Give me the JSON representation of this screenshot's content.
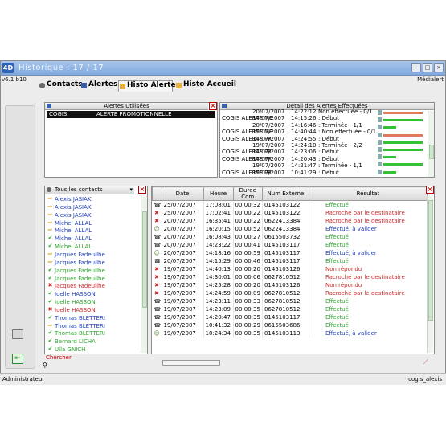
{
  "window": {
    "title": "Historique : 17 / 17",
    "version": "v6.1 b10",
    "org": "Médialert"
  },
  "tabs": [
    {
      "label": "Contacts",
      "icon": "person-icon"
    },
    {
      "label": "Alertes",
      "icon": "speaker-icon"
    },
    {
      "label": "Histo Alertes",
      "icon": "arrow-icon",
      "active": true
    },
    {
      "label": "Histo Accueil",
      "icon": "arrow-icon"
    }
  ],
  "alerts_used": {
    "title": "Alertes Utilisées",
    "rows": [
      {
        "name": "COGIS",
        "type": "ALERTE PROMOTIONNELLE"
      }
    ]
  },
  "alert_details": {
    "title": "Détail des Alertes Effectuées",
    "lines": [
      {
        "left": "",
        "date": "20/07/2007",
        "time": "14:22:12",
        "status": "Non effectuée - 0/1"
      },
      {
        "left": "COGIS ALERTE ME",
        "date": "14/07/2007",
        "time": "14:15:26",
        "status": ": Début"
      },
      {
        "left": "",
        "date": "20/07/2007",
        "time": "14:16:46",
        "status": ": Terminée - 1/1"
      },
      {
        "left": "COGIS ALERTE ME",
        "date": "19/07/2007",
        "time": "14:40:44",
        "status": ": Non effectuée - 0/1"
      },
      {
        "left": "COGIS ALERTE PR",
        "date": "14/07/2007",
        "time": "14:24:55",
        "status": ": Début"
      },
      {
        "left": "",
        "date": "19/07/2007",
        "time": "14:24:10",
        "status": ": Terminée - 2/2"
      },
      {
        "left": "COGIS ALERTE PR",
        "date": "14/07/2007",
        "time": "14:23:06",
        "status": ": Début"
      },
      {
        "left": "COGIS ALERTE PR",
        "date": "14/07/2007",
        "time": "14:20:43",
        "status": ": Début"
      },
      {
        "left": "",
        "date": "19/07/2007",
        "time": "14:21:47",
        "status": ": Terminée - 1/1"
      },
      {
        "left": "COGIS ALERTE PR",
        "date": "19/07/2007",
        "time": "10:41:29",
        "status": ": Début"
      }
    ],
    "bars": [
      {
        "color": "#e07a5a",
        "fill": 0.95
      },
      {
        "color": "#33c233",
        "fill": 0.95
      },
      {
        "color": "#33c233",
        "fill": 0.3
      },
      {
        "color": "#e07a5a",
        "fill": 0.95
      },
      {
        "color": "#33c233",
        "fill": 0.95
      },
      {
        "color": "#33c233",
        "fill": 0.95
      },
      {
        "color": "#33c233",
        "fill": 0.3
      },
      {
        "color": "#33c233",
        "fill": 0.95
      },
      {
        "color": "#33c233",
        "fill": 0.3
      }
    ]
  },
  "contacts": {
    "filter": "Tous les contacts",
    "search_label": "Chercher",
    "items": [
      {
        "name": "Alexis JASIAK",
        "mark": "right",
        "color": "#1f3fb8"
      },
      {
        "name": "Alexis JASIAK",
        "mark": "right",
        "color": "#1f3fb8"
      },
      {
        "name": "Alexis JASIAK",
        "mark": "right",
        "color": "#1f3fb8"
      },
      {
        "name": "Michel ALLAL",
        "mark": "right",
        "color": "#1f3fb8"
      },
      {
        "name": "Michel ALLAL",
        "mark": "right",
        "color": "#1f3fb8"
      },
      {
        "name": "Michel ALLAL",
        "mark": "check",
        "color": "#1f3fb8"
      },
      {
        "name": "Michel ALLAL",
        "mark": "check",
        "color": "#2ea52e"
      },
      {
        "name": "Jacques Fadeuilhe",
        "mark": "right",
        "color": "#1f3fb8"
      },
      {
        "name": "Jacques Fadeuilhe",
        "mark": "right",
        "color": "#1f3fb8"
      },
      {
        "name": "Jacques Fadeuilhe",
        "mark": "check",
        "color": "#2ea52e"
      },
      {
        "name": "Jacques Fadeuilhe",
        "mark": "check",
        "color": "#2ea52e"
      },
      {
        "name": "Jacques Fadeuilhe",
        "mark": "cross",
        "color": "#cc2a2a"
      },
      {
        "name": "Ioelle HASSON",
        "mark": "check",
        "color": "#1f3fb8"
      },
      {
        "name": "Ioelle HASSON",
        "mark": "check",
        "color": "#2ea52e"
      },
      {
        "name": "Ioelle HASSON",
        "mark": "cross",
        "color": "#cc2a2a"
      },
      {
        "name": "Thomas BLETTERI",
        "mark": "check",
        "color": "#1f3fb8"
      },
      {
        "name": "Thomas BLETTERI",
        "mark": "right",
        "color": "#1f3fb8"
      },
      {
        "name": "Thomas BLETTERI",
        "mark": "check",
        "color": "#2ea52e"
      },
      {
        "name": "Bernard LICHA",
        "mark": "check",
        "color": "#2ea52e"
      },
      {
        "name": "Ulla GNICH",
        "mark": "check",
        "color": "#2ea52e"
      }
    ]
  },
  "calls": {
    "headers": [
      "Date",
      "Heure",
      "Duree Com",
      "Num Externe",
      "Résultat"
    ],
    "rows": [
      {
        "icon": "phone",
        "date": "25/07/2007",
        "heure": "17:08:01",
        "duree": "00:00:32",
        "num": "0145103122",
        "resultat": "Effectué",
        "rcolor": "#2ea52e"
      },
      {
        "icon": "cross",
        "date": "25/07/2007",
        "heure": "17:02:41",
        "duree": "00:00:22",
        "num": "0145103122",
        "resultat": "Racroché par le destinataire",
        "rcolor": "#cc2a2a"
      },
      {
        "icon": "cross",
        "date": "20/07/2007",
        "heure": "16:35:41",
        "duree": "00:00:22",
        "num": "0622413384",
        "resultat": "Racroché par le destinataire",
        "rcolor": "#cc2a2a"
      },
      {
        "icon": "person",
        "date": "20/07/2007",
        "heure": "16:20:15",
        "duree": "00:00:52",
        "num": "0622413384",
        "resultat": "Effectué, à valider",
        "rcolor": "#1f3fb8"
      },
      {
        "icon": "phone",
        "date": "20/07/2007",
        "heure": "16:08:43",
        "duree": "00:00:27",
        "num": "0615503732",
        "resultat": "Effectué",
        "rcolor": "#2ea52e"
      },
      {
        "icon": "phone",
        "date": "20/07/2007",
        "heure": "14:23:22",
        "duree": "00:00:41",
        "num": "0145103117",
        "resultat": "Effectué",
        "rcolor": "#2ea52e"
      },
      {
        "icon": "person",
        "date": "20/07/2007",
        "heure": "14:18:16",
        "duree": "00:00:59",
        "num": "0145103117",
        "resultat": "Effectué, à valider",
        "rcolor": "#1f3fb8"
      },
      {
        "icon": "phone",
        "date": "20/07/2007",
        "heure": "14:15:29",
        "duree": "00:00:46",
        "num": "0145103117",
        "resultat": "Effectué",
        "rcolor": "#2ea52e"
      },
      {
        "icon": "cross",
        "date": "19/07/2007",
        "heure": "14:40:13",
        "duree": "00:00:20",
        "num": "0145103126",
        "resultat": "Non répondu",
        "rcolor": "#cc2a2a"
      },
      {
        "icon": "cross",
        "date": "19/07/2007",
        "heure": "14:30:01",
        "duree": "00:00:06",
        "num": "0627810512",
        "resultat": "Racroché par le destinataire",
        "rcolor": "#cc2a2a"
      },
      {
        "icon": "cross",
        "date": "19/07/2007",
        "heure": "14:25:28",
        "duree": "00:00:20",
        "num": "0145103126",
        "resultat": "Non répondu",
        "rcolor": "#cc2a2a"
      },
      {
        "icon": "cross",
        "date": "19/07/2007",
        "heure": "14:24:59",
        "duree": "00:00:09",
        "num": "0627810512",
        "resultat": "Racroché par le destinataire",
        "rcolor": "#cc2a2a"
      },
      {
        "icon": "phone",
        "date": "19/07/2007",
        "heure": "14:23:11",
        "duree": "00:00:33",
        "num": "0627810512",
        "resultat": "Effectué",
        "rcolor": "#2ea52e"
      },
      {
        "icon": "phone",
        "date": "19/07/2007",
        "heure": "14:23:09",
        "duree": "00:00:35",
        "num": "0627810512",
        "resultat": "Effectué",
        "rcolor": "#2ea52e"
      },
      {
        "icon": "phone",
        "date": "19/07/2007",
        "heure": "14:20:47",
        "duree": "00:00:35",
        "num": "0145103117",
        "resultat": "Effectué",
        "rcolor": "#2ea52e"
      },
      {
        "icon": "phone",
        "date": "19/07/2007",
        "heure": "10:41:32",
        "duree": "00:00:29",
        "num": "0615503686",
        "resultat": "Effectué",
        "rcolor": "#2ea52e"
      },
      {
        "icon": "person",
        "date": "19/07/2007",
        "heure": "10:24:34",
        "duree": "00:00:35",
        "num": "0145103113",
        "resultat": "Effectué, à valider",
        "rcolor": "#1f3fb8"
      }
    ]
  },
  "status": {
    "left": "Administrateur",
    "right": "cogis_alexis"
  }
}
